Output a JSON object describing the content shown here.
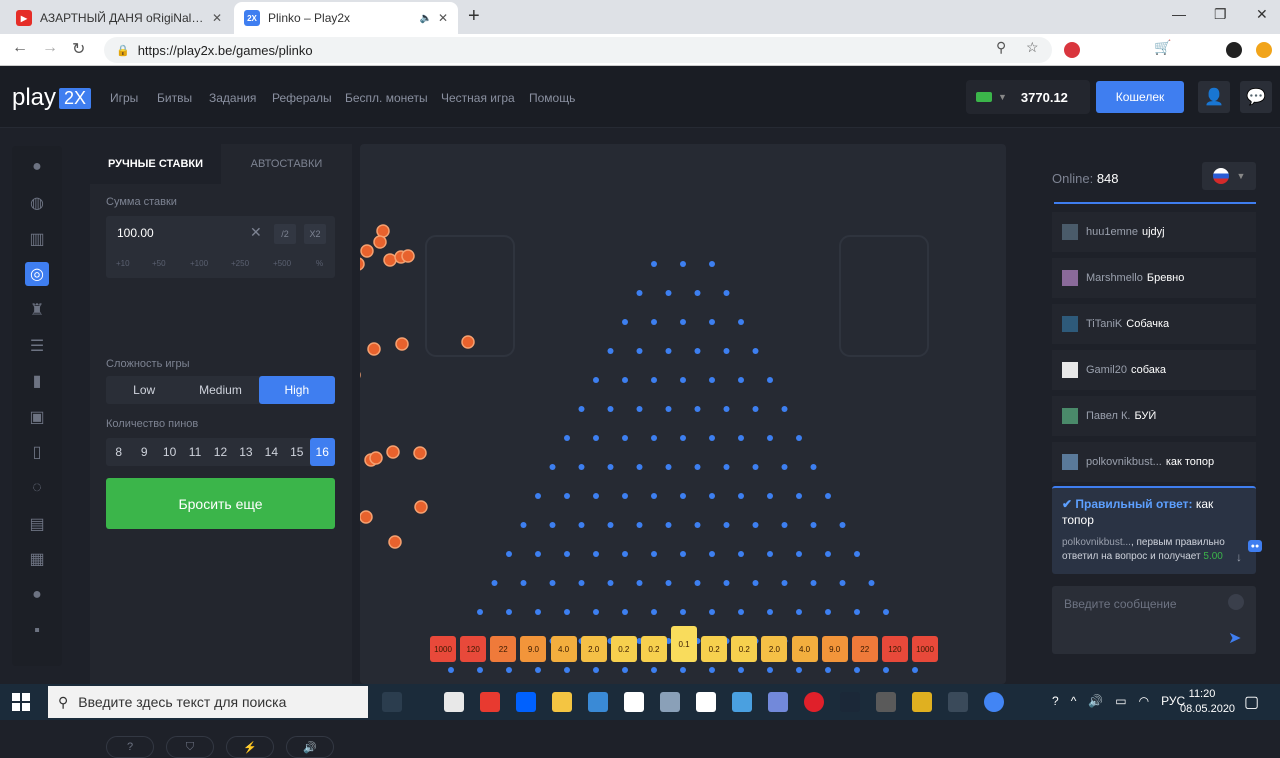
{
  "browser": {
    "tabs": [
      {
        "title": "АЗАРТНЫЙ ДАНЯ oRigiNal - You",
        "active": false,
        "icon": "youtube-icon"
      },
      {
        "title": "Plinko – Play2x",
        "active": true,
        "icon": "play2x-favicon"
      }
    ],
    "url": "https://play2x.be/games/plinko",
    "favicon_label": "2X"
  },
  "site": {
    "logo": {
      "text": "play",
      "badge": "2X"
    },
    "nav": [
      "Игры",
      "Битвы",
      "Задания",
      "Рефералы",
      "Беспл. монеты",
      "Честная игра",
      "Помощь"
    ],
    "balance": "3770.12",
    "wallet_label": "Кошелек"
  },
  "sidebar_icons": [
    "drop-icon",
    "basketball-icon",
    "tower-icon",
    "plinko-icon",
    "slot-machine-icon",
    "ladder-icon",
    "bar-chart-icon",
    "dice-icon",
    "card-icon",
    "ring-icon",
    "blackjack-icon",
    "keno-icon",
    "circle-icon",
    "nine-icon"
  ],
  "panel": {
    "tabs": [
      "РУЧНЫЕ СТАВКИ",
      "АВТОСТАВКИ"
    ],
    "bet_label": "Сумма ставки",
    "bet_value": "100.00",
    "bet_half": "/2",
    "bet_double": "X2",
    "quick_bets": [
      "+10",
      "+50",
      "+100",
      "+250",
      "+500",
      "%"
    ],
    "difficulty_label": "Сложность игры",
    "difficulty": [
      "Low",
      "Medium",
      "High"
    ],
    "difficulty_active": "High",
    "pins_label": "Количество пинов",
    "pins": [
      "8",
      "9",
      "10",
      "11",
      "12",
      "13",
      "14",
      "15",
      "16"
    ],
    "pins_active": "16",
    "drop_label": "Бросить еще"
  },
  "board": {
    "rows": 16,
    "multipliers": [
      "1000",
      "120",
      "22",
      "9.0",
      "4.0",
      "2.0",
      "0.2",
      "0.2",
      "0.1",
      "0.2",
      "0.2",
      "2.0",
      "4.0",
      "9.0",
      "22",
      "120",
      "1000"
    ],
    "slot_colors": [
      "#e8493a",
      "#e8493a",
      "#ef7a3a",
      "#f2953a",
      "#f3ae3e",
      "#f5c046",
      "#f7d04e",
      "#f7d04e",
      "#f9dc5c",
      "#f7d04e",
      "#f7d04e",
      "#f5c046",
      "#f3ae3e",
      "#f2953a",
      "#ef7a3a",
      "#e8493a",
      "#e8493a"
    ],
    "pin_color": "#3d7ff0",
    "ball_color": "#e8622d"
  },
  "chat": {
    "online_label": "Online:",
    "online_count": "848",
    "messages": [
      {
        "user": "huu1emne",
        "text": "ujdyj"
      },
      {
        "user": "Marshmello",
        "text": "Бревно"
      },
      {
        "user": "TiTaniK",
        "text": "Собачка"
      },
      {
        "user": "Gamil20",
        "text": "собака"
      },
      {
        "user": "Павел К.",
        "text": "БУЙ"
      },
      {
        "user": "polkovnikbust...",
        "text": "как топор"
      }
    ],
    "quiz_header": "Правильный ответ:",
    "quiz_answer": "как топор",
    "quiz_user": "polkovnikbust...",
    "quiz_text": ", первым правильно ответил на вопрос и получает",
    "quiz_amount": "5.00",
    "input_placeholder": "Введите сообщение"
  },
  "taskbar": {
    "search_placeholder": "Введите здесь текст для поиска",
    "lang": "РУС",
    "time": "11:20",
    "date": "08.05.2020"
  }
}
